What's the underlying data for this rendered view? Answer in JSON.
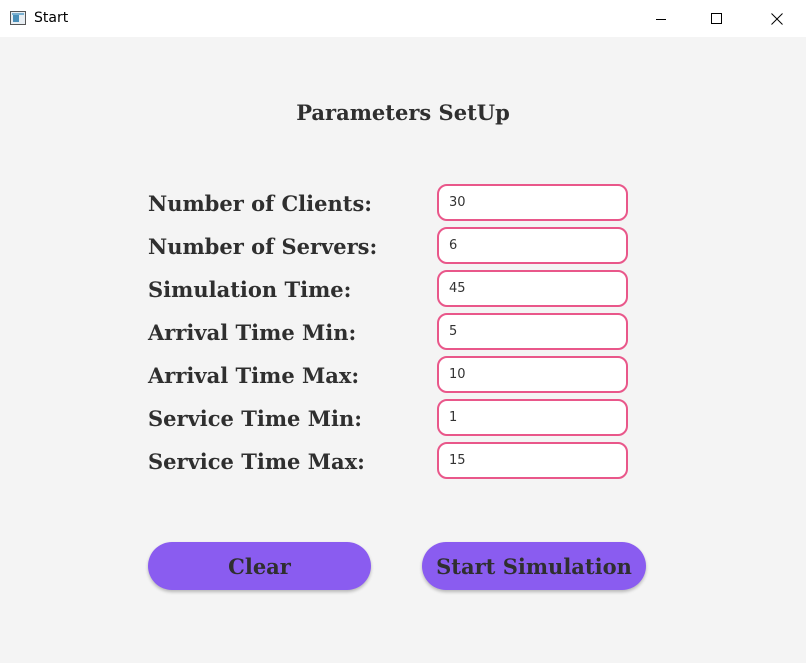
{
  "window": {
    "title": "Start",
    "icon": "java-app-icon"
  },
  "form": {
    "heading": "Parameters SetUp",
    "fields": [
      {
        "label": "Number of Clients:",
        "value": "30"
      },
      {
        "label": "Number of Servers:",
        "value": "6"
      },
      {
        "label": "Simulation Time:",
        "value": "45"
      },
      {
        "label": "Arrival Time Min:",
        "value": "5"
      },
      {
        "label": "Arrival Time Max:",
        "value": "10"
      },
      {
        "label": "Service Time Min:",
        "value": "1"
      },
      {
        "label": "Service Time Max:",
        "value": "15"
      }
    ]
  },
  "buttons": {
    "clear": "Clear",
    "start": "Start Simulation"
  },
  "colors": {
    "background": "#f4f4f4",
    "input_border": "#e9578a",
    "button_fill": "#8a5cf0",
    "text": "#2f2f2f"
  }
}
